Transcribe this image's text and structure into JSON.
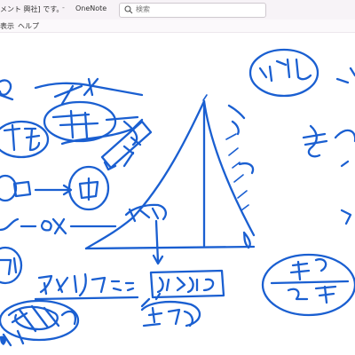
{
  "window": {
    "title": "メント 興社] です。",
    "separator": "-",
    "app_name": "OneNote"
  },
  "search": {
    "placeholder": "検索"
  },
  "menu": {
    "items": [
      {
        "label": "表示"
      },
      {
        "label": "ヘルプ"
      }
    ]
  },
  "colors": {
    "ink": "#1a5fd1",
    "titlebar": "#f7f3f7"
  }
}
